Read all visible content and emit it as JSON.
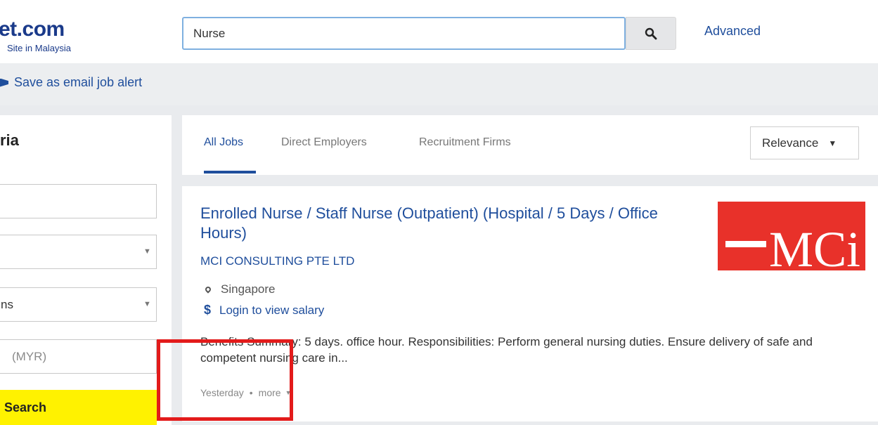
{
  "header": {
    "logo_main": "et.com",
    "logo_sub": "Site in Malaysia",
    "search_value": "Nurse",
    "search_icon": "search-icon",
    "advanced_label": "Advanced"
  },
  "toolbar": {
    "alert_icon": "bell-icon",
    "alert_label": "Save as email job alert"
  },
  "sidebar": {
    "title": "ria",
    "field1_value": "",
    "field2_value": "",
    "field3_value": "ns",
    "salary_placeholder": "(MYR)",
    "search_label": "Search"
  },
  "tabs": [
    {
      "label": "All Jobs",
      "active": true
    },
    {
      "label": "Direct Employers",
      "active": false
    },
    {
      "label": "Recruitment Firms",
      "active": false
    }
  ],
  "sort": {
    "selected": "Relevance",
    "caret": "▼"
  },
  "job": {
    "title": "Enrolled Nurse / Staff Nurse (Outpatient) (Hospital / 5 Days / Office Hours)",
    "company": "MCI CONSULTING PTE LTD",
    "location": "Singapore",
    "salary": "Login to view salary",
    "description": "Benefits Summary: 5 days. office hour. Responsibilities: Perform general nursing duties. Ensure delivery of safe and competent nursing care in...",
    "posted": "Yesterday",
    "separator": "•",
    "more_label": "more",
    "logo_text": "MCi",
    "logo_color": "#e8312a"
  },
  "colors": {
    "link": "#1f4e9c",
    "search_button": "#fff200",
    "annotation": "#e31b1b"
  }
}
